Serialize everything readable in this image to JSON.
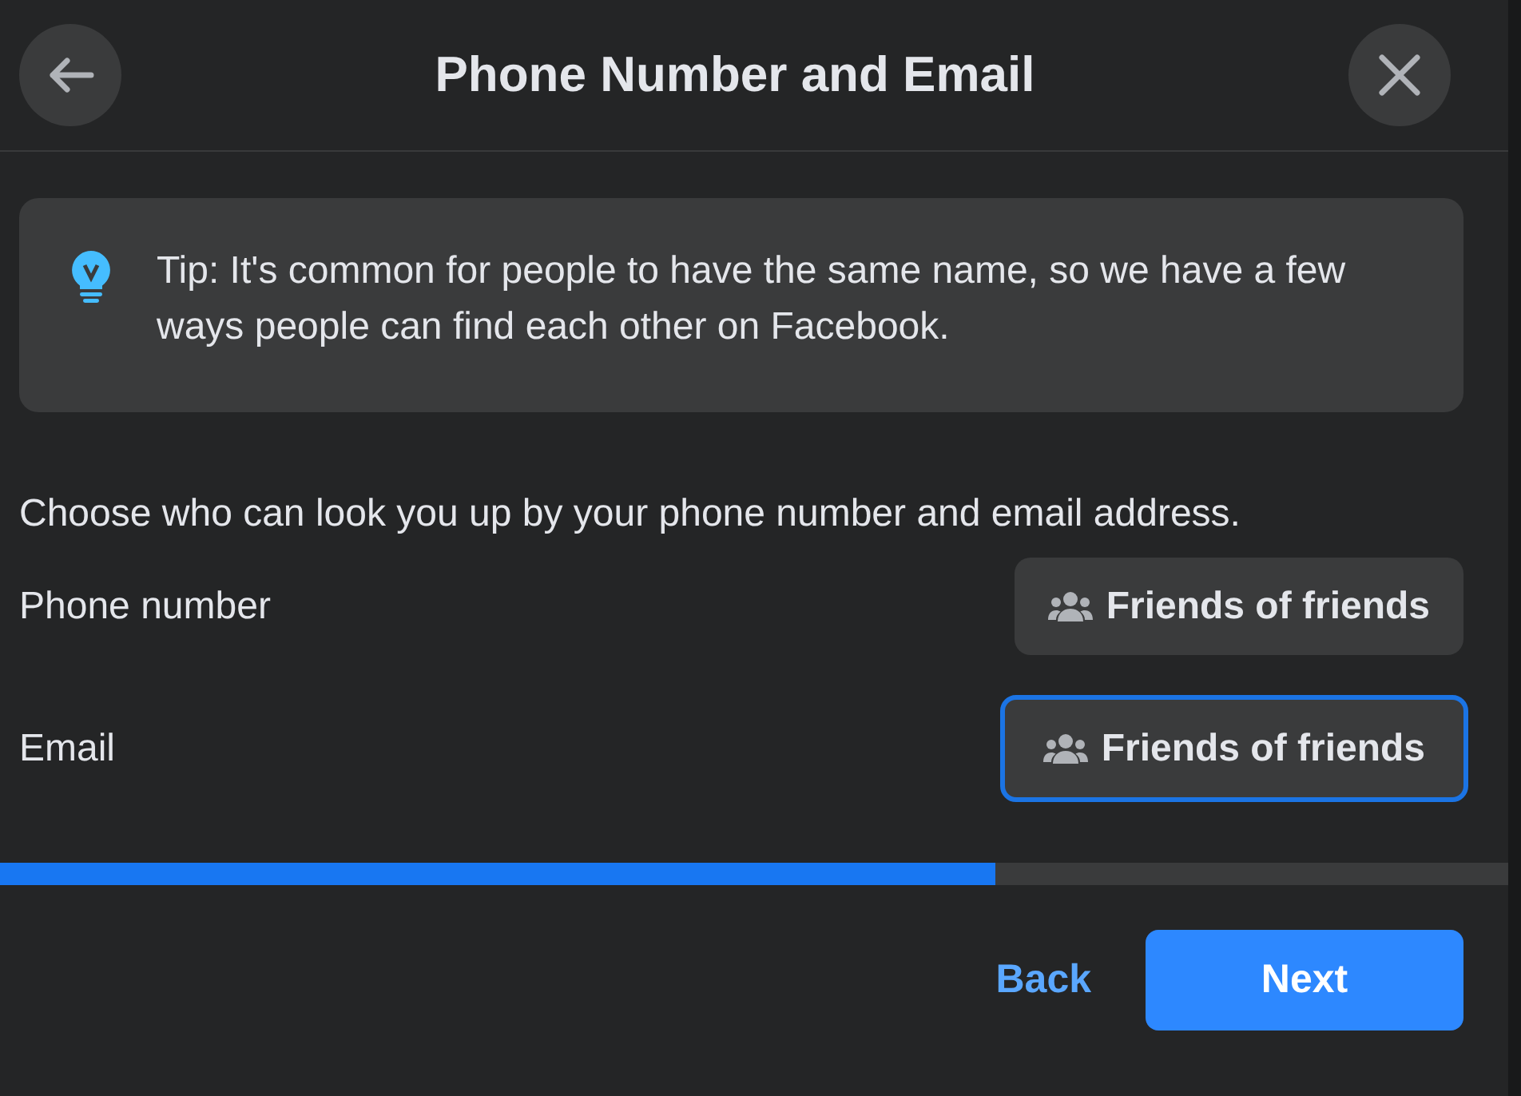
{
  "header": {
    "title": "Phone Number and Email"
  },
  "tip": {
    "text": "Tip: It's common for people to have the same name, so we have a few ways people can find each other on Facebook."
  },
  "prompt": "Choose who can look you up by your phone number and email address.",
  "settings": [
    {
      "label": "Phone number",
      "audience": "Friends of friends",
      "focused": false
    },
    {
      "label": "Email",
      "audience": "Friends of friends",
      "focused": true
    }
  ],
  "progress": {
    "level": 0.66
  },
  "footer": {
    "back": "Back",
    "next": "Next"
  }
}
